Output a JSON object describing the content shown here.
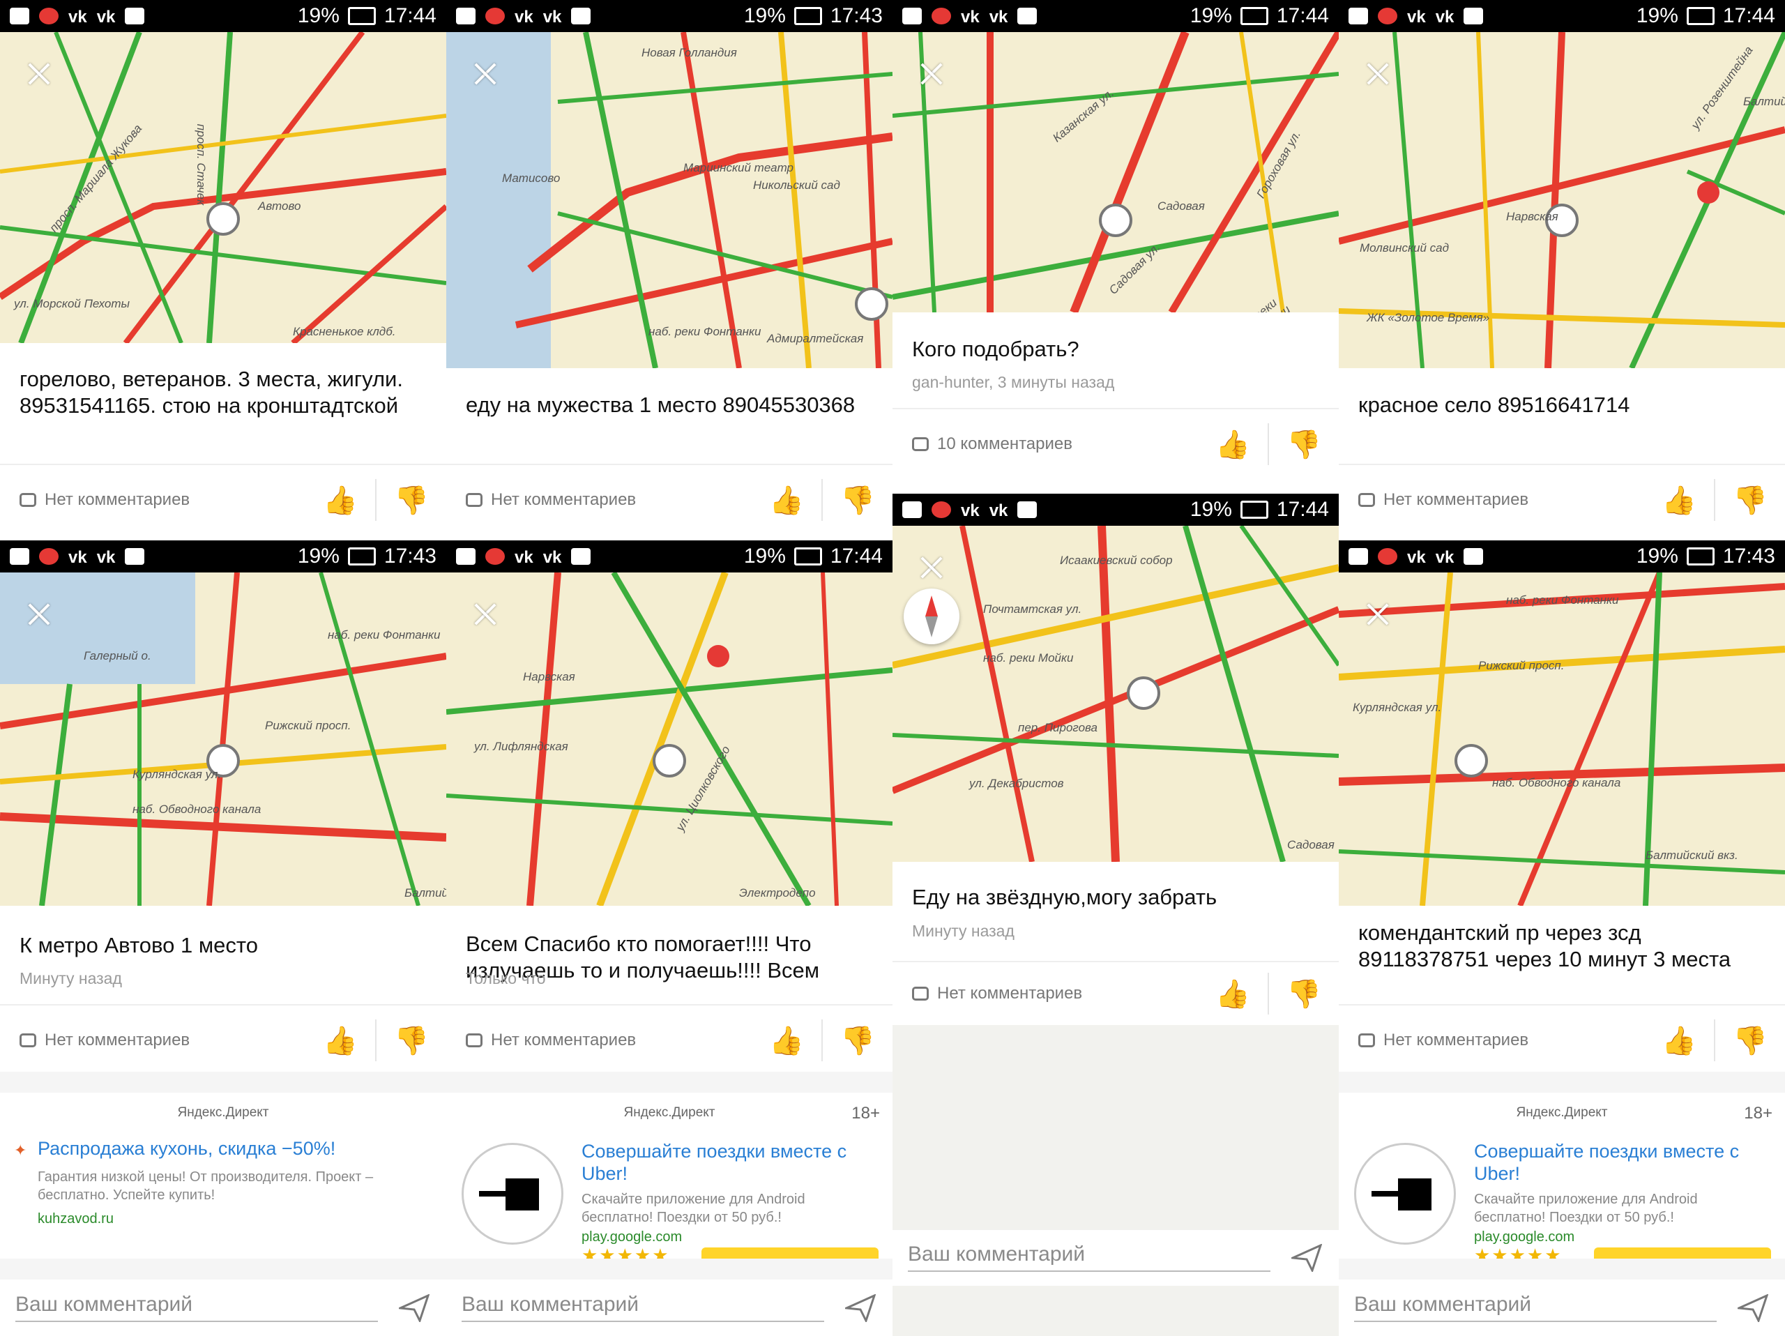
{
  "status_bars": [
    {
      "battery": "19%",
      "time": "17:44",
      "vk": "vk"
    },
    {
      "battery": "19%",
      "time": "17:43",
      "vk": "vk"
    },
    {
      "battery": "19%",
      "time": "17:44",
      "vk": "vk"
    },
    {
      "battery": "19%",
      "time": "17:44",
      "vk": "vk"
    },
    {
      "battery": "19%",
      "time": "17:43",
      "vk": "vk"
    },
    {
      "battery": "19%",
      "time": "17:44",
      "vk": "vk"
    },
    {
      "battery": "19%",
      "time": "17:44",
      "vk": "vk"
    },
    {
      "battery": "19%",
      "time": "17:43",
      "vk": "vk"
    }
  ],
  "cards": {
    "c1": {
      "text": "горелово, ветеранов. 3 места, жигули. 89531541165. стою на кронштадтской",
      "comments": "Нет комментариев"
    },
    "c2": {
      "text": "еду на мужества 1 место 89045530368",
      "comments": "Нет комментариев"
    },
    "c3": {
      "text": "Кого подобрать?",
      "meta": "gan-hunter, 3 минуты назад",
      "comments": "10 комментариев"
    },
    "c4": {
      "text": "красное село 89516641714",
      "comments": "Нет комментариев"
    },
    "c5": {
      "text": "К метро Автово 1 место",
      "meta": "Минуту назад",
      "comments": "Нет комментариев"
    },
    "c6": {
      "text": "Всем Спасибо кто помогает!!!! Что излучаешь то и получаешь!!!! Всем",
      "meta": "Только что",
      "comments": "Нет комментариев"
    },
    "c7": {
      "text": "Еду на звёздную,могу забрать",
      "meta": "Минуту назад",
      "comments": "Нет комментариев"
    },
    "c8": {
      "text": "комендантский пр через зсд 89118378751 через 10 минут 3 места",
      "comments": "Нет комментариев"
    }
  },
  "ads": {
    "kitchen": {
      "source": "Яндекс.Директ",
      "title": "Распродажа кухонь, скидка −50%!",
      "desc": "Гарантия низкой цены! От производителя. Проект – бесплатно. Успейте купить!",
      "domain": "kuhzavod.ru"
    },
    "uber": {
      "source": "Яндекс.Директ",
      "age": "18+",
      "title": "Совершайте поездки вместе с Uber!",
      "desc": "Скачайте приложение для Android бесплатно! Поездки от 50 руб.!",
      "domain": "play.google.com",
      "stars": "★★★★★"
    }
  },
  "comment_input": {
    "placeholder": "Ваш комментарий"
  },
  "map_labels": {
    "m1": [
      "просп. Маршала Жукова",
      "просп. Стачек",
      "Автово",
      "ул. Морской Пехоты",
      "Красненькое клдб."
    ],
    "m2": [
      "Новая Голландия",
      "Матисово",
      "Мариинский театр",
      "Никольский сад",
      "наб. реки Фонтанки",
      "Адмиралтейская"
    ],
    "m3": [
      "Садовая ул.",
      "Садовая",
      "Гороховая ул.",
      "наб. реки Фонтанки",
      "Казанская ул."
    ],
    "m4": [
      "Молвинский сад",
      "ЖК «Золотое Время»",
      "Нарвская",
      "ул. Розенштейна",
      "Балтийская"
    ],
    "m5": [
      "Галерный о.",
      "наб. реки Фонтанки",
      "Рижский просп.",
      "Курляндская ул.",
      "наб. Обводного канала",
      "Балтийская"
    ],
    "m6": [
      "Нарвская",
      "ул. Лифляндская",
      "ул. Циолковского",
      "Электродепо"
    ],
    "m7": [
      "Исаакиевский собор",
      "Почтамтская ул.",
      "наб. реки Мойки",
      "пер. Пирогова",
      "ул. Декабристов",
      "Садовая"
    ],
    "m8": [
      "наб. реки Фонтанки",
      "Рижский просп.",
      "Курляндская ул.",
      "наб. Обводного канала",
      "Балтийский вкз."
    ]
  }
}
